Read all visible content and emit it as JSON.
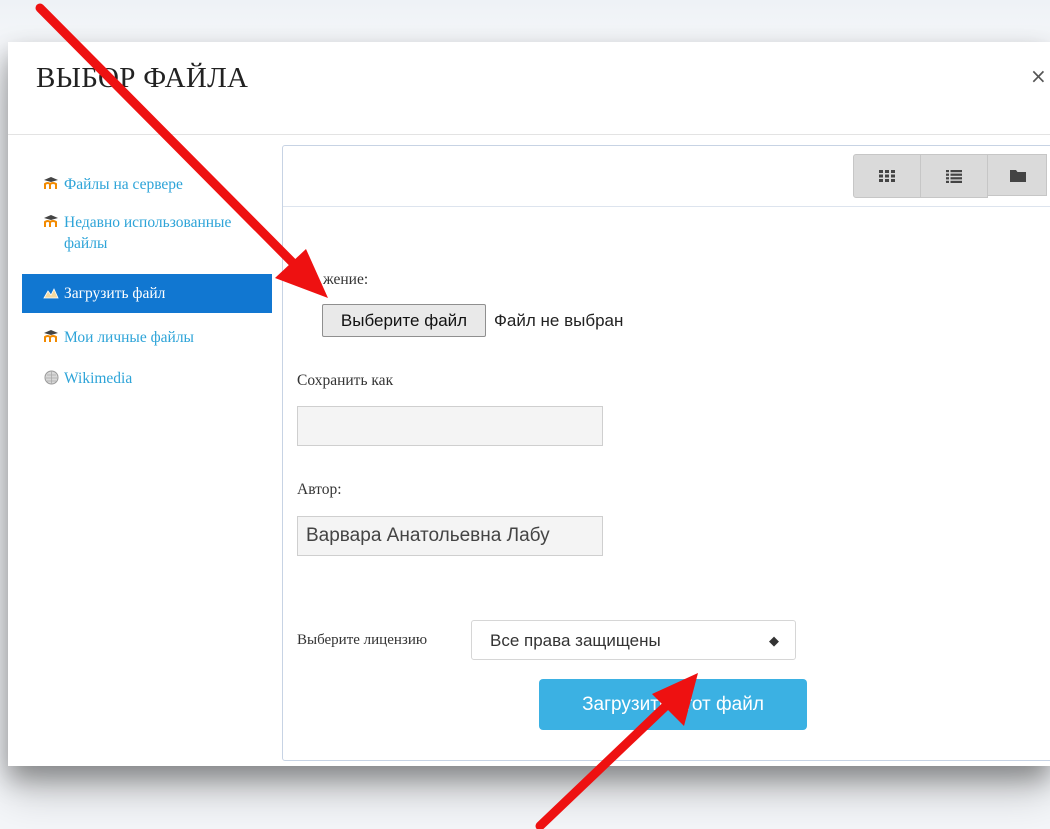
{
  "dialog": {
    "title": "ВЫБОР ФАЙЛА",
    "close_label": "×"
  },
  "sidebar": {
    "items": [
      {
        "label": "Файлы на сервере",
        "icon": "moodle-icon"
      },
      {
        "label": "Недавно использованные файлы",
        "icon": "moodle-icon"
      },
      {
        "label": "Загрузить файл",
        "icon": "upload-icon",
        "active": true
      },
      {
        "label": "Мои личные файлы",
        "icon": "moodle-icon"
      },
      {
        "label": "Wikimedia",
        "icon": "wikimedia-icon"
      }
    ]
  },
  "toolbar": {
    "views": [
      "grid-view-icon",
      "list-view-icon",
      "folder-view-icon"
    ]
  },
  "form": {
    "attachment_label": "жение:",
    "choose_file_label": "Выберите файл",
    "file_status": "Файл не выбран",
    "save_as_label": "Сохранить как",
    "save_as_value": "",
    "author_label": "Автор:",
    "author_value": "Варвара Анатольевна Лабу",
    "license_label": "Выберите лицензию",
    "license_value": "Все права защищены",
    "submit_label": "Загрузить этот файл"
  },
  "colors": {
    "accent": "#1177d1",
    "link": "#2ea4d8",
    "submit": "#3bb1e3",
    "annotation_arrow": "#ee1111"
  }
}
